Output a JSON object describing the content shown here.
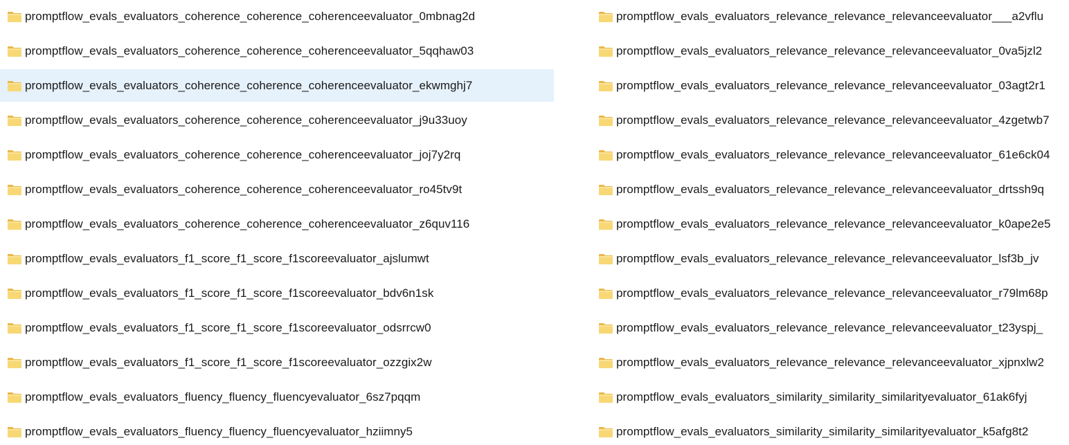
{
  "colors": {
    "selected_bg": "#e5f1fb",
    "folder_fill": "#f8d775",
    "folder_tab": "#e8b84a"
  },
  "icon": "folder-icon",
  "left_column": [
    {
      "name": "promptflow_evals_evaluators_coherence_coherence_coherenceevaluator_0mbnag2d",
      "selected": false
    },
    {
      "name": "promptflow_evals_evaluators_coherence_coherence_coherenceevaluator_5qqhaw03",
      "selected": false
    },
    {
      "name": "promptflow_evals_evaluators_coherence_coherence_coherenceevaluator_ekwmghj7",
      "selected": true
    },
    {
      "name": "promptflow_evals_evaluators_coherence_coherence_coherenceevaluator_j9u33uoy",
      "selected": false
    },
    {
      "name": "promptflow_evals_evaluators_coherence_coherence_coherenceevaluator_joj7y2rq",
      "selected": false
    },
    {
      "name": "promptflow_evals_evaluators_coherence_coherence_coherenceevaluator_ro45tv9t",
      "selected": false
    },
    {
      "name": "promptflow_evals_evaluators_coherence_coherence_coherenceevaluator_z6quv116",
      "selected": false
    },
    {
      "name": "promptflow_evals_evaluators_f1_score_f1_score_f1scoreevaluator_ajslumwt",
      "selected": false
    },
    {
      "name": "promptflow_evals_evaluators_f1_score_f1_score_f1scoreevaluator_bdv6n1sk",
      "selected": false
    },
    {
      "name": "promptflow_evals_evaluators_f1_score_f1_score_f1scoreevaluator_odsrrcw0",
      "selected": false
    },
    {
      "name": "promptflow_evals_evaluators_f1_score_f1_score_f1scoreevaluator_ozzgix2w",
      "selected": false
    },
    {
      "name": "promptflow_evals_evaluators_fluency_fluency_fluencyevaluator_6sz7pqqm",
      "selected": false
    },
    {
      "name": "promptflow_evals_evaluators_fluency_fluency_fluencyevaluator_hziimny5",
      "selected": false
    }
  ],
  "right_column": [
    {
      "name": "promptflow_evals_evaluators_relevance_relevance_relevanceevaluator___a2vflu",
      "selected": false
    },
    {
      "name": "promptflow_evals_evaluators_relevance_relevance_relevanceevaluator_0va5jzl2",
      "selected": false
    },
    {
      "name": "promptflow_evals_evaluators_relevance_relevance_relevanceevaluator_03agt2r1",
      "selected": false
    },
    {
      "name": "promptflow_evals_evaluators_relevance_relevance_relevanceevaluator_4zgetwb7",
      "selected": false
    },
    {
      "name": "promptflow_evals_evaluators_relevance_relevance_relevanceevaluator_61e6ck04",
      "selected": false
    },
    {
      "name": "promptflow_evals_evaluators_relevance_relevance_relevanceevaluator_drtssh9q",
      "selected": false
    },
    {
      "name": "promptflow_evals_evaluators_relevance_relevance_relevanceevaluator_k0ape2e5",
      "selected": false
    },
    {
      "name": "promptflow_evals_evaluators_relevance_relevance_relevanceevaluator_lsf3b_jv",
      "selected": false
    },
    {
      "name": "promptflow_evals_evaluators_relevance_relevance_relevanceevaluator_r79lm68p",
      "selected": false
    },
    {
      "name": "promptflow_evals_evaluators_relevance_relevance_relevanceevaluator_t23yspj_",
      "selected": false
    },
    {
      "name": "promptflow_evals_evaluators_relevance_relevance_relevanceevaluator_xjpnxlw2",
      "selected": false
    },
    {
      "name": "promptflow_evals_evaluators_similarity_similarity_similarityevaluator_61ak6fyj",
      "selected": false
    },
    {
      "name": "promptflow_evals_evaluators_similarity_similarity_similarityevaluator_k5afg8t2",
      "selected": false
    }
  ]
}
